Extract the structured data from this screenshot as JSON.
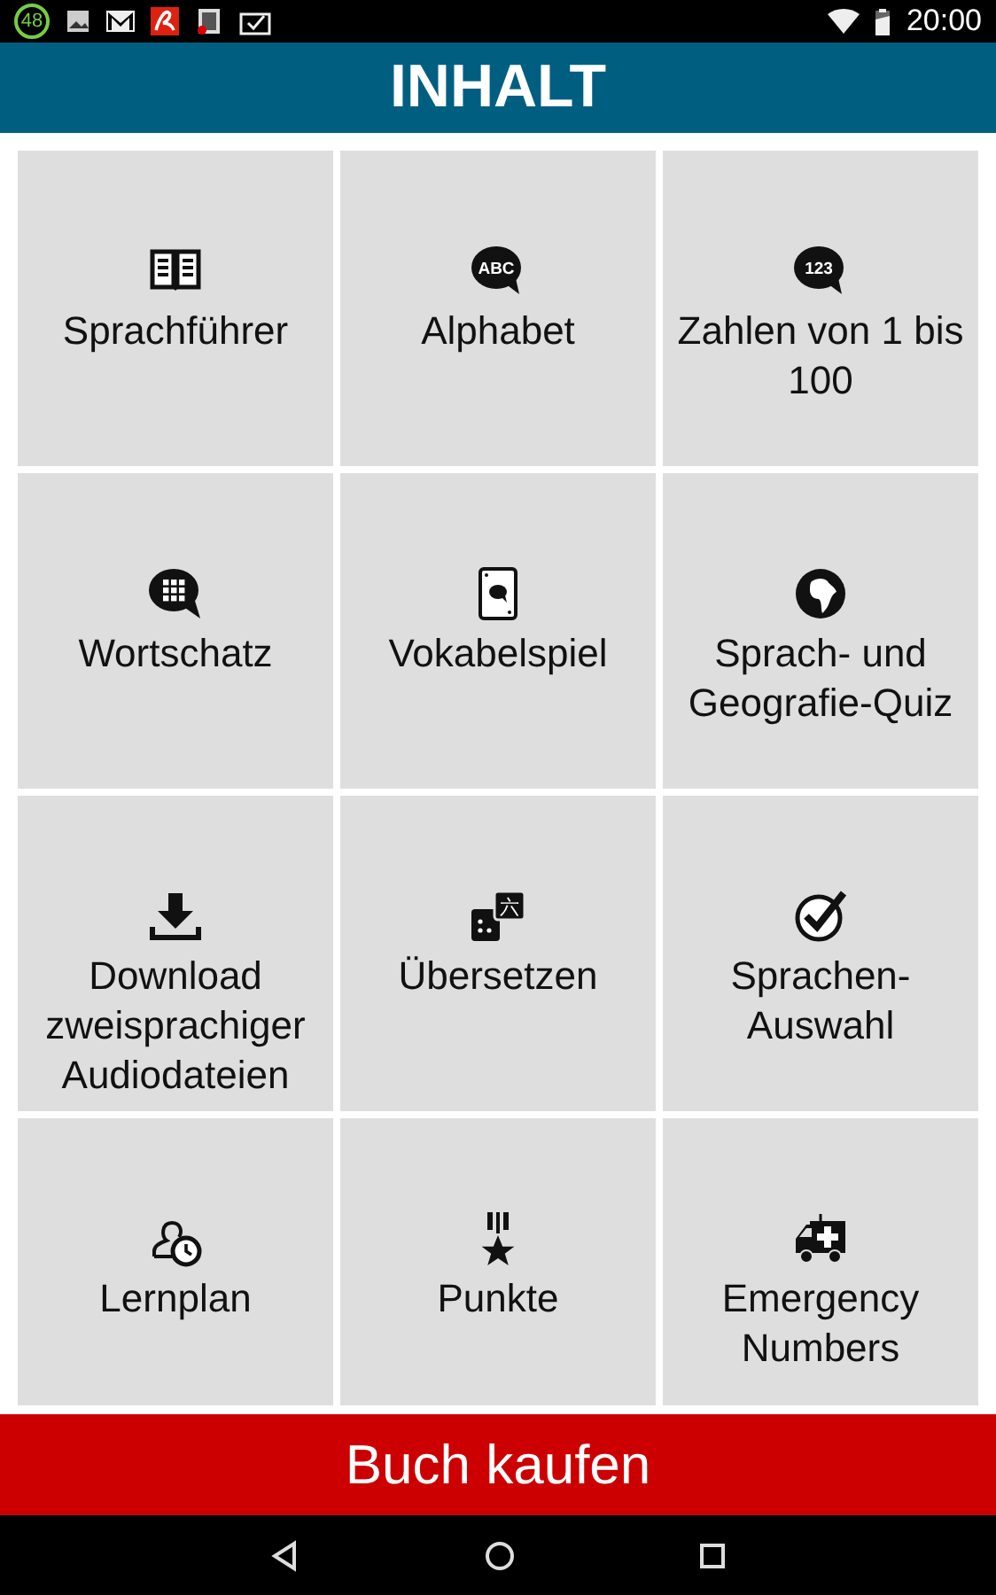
{
  "status_bar": {
    "notification_count": "48",
    "time": "20:00"
  },
  "header": {
    "title": "INHALT"
  },
  "tiles": [
    {
      "kind": "book",
      "label": "Sprachführer"
    },
    {
      "kind": "bubble",
      "icon_text": "ABC",
      "label": "Alphabet"
    },
    {
      "kind": "bubble",
      "icon_text": "123",
      "label": "Zahlen von 1 bis 100"
    },
    {
      "kind": "grid-bubble",
      "label": "Wortschatz"
    },
    {
      "kind": "card",
      "label": "Vokabelspiel"
    },
    {
      "kind": "globe",
      "label": "Sprach- und Geografie-Quiz"
    },
    {
      "kind": "download",
      "label": "Download zweisprachiger Audiodateien"
    },
    {
      "kind": "translate",
      "icon_text": "六",
      "label": "Übersetzen"
    },
    {
      "kind": "check",
      "label": "Sprachen-Auswahl"
    },
    {
      "kind": "person-clock",
      "label": "Lernplan"
    },
    {
      "kind": "medal",
      "label": "Punkte"
    },
    {
      "kind": "ambulance",
      "label": "Emergency Numbers"
    }
  ],
  "buy_button": {
    "label": "Buch kaufen"
  }
}
